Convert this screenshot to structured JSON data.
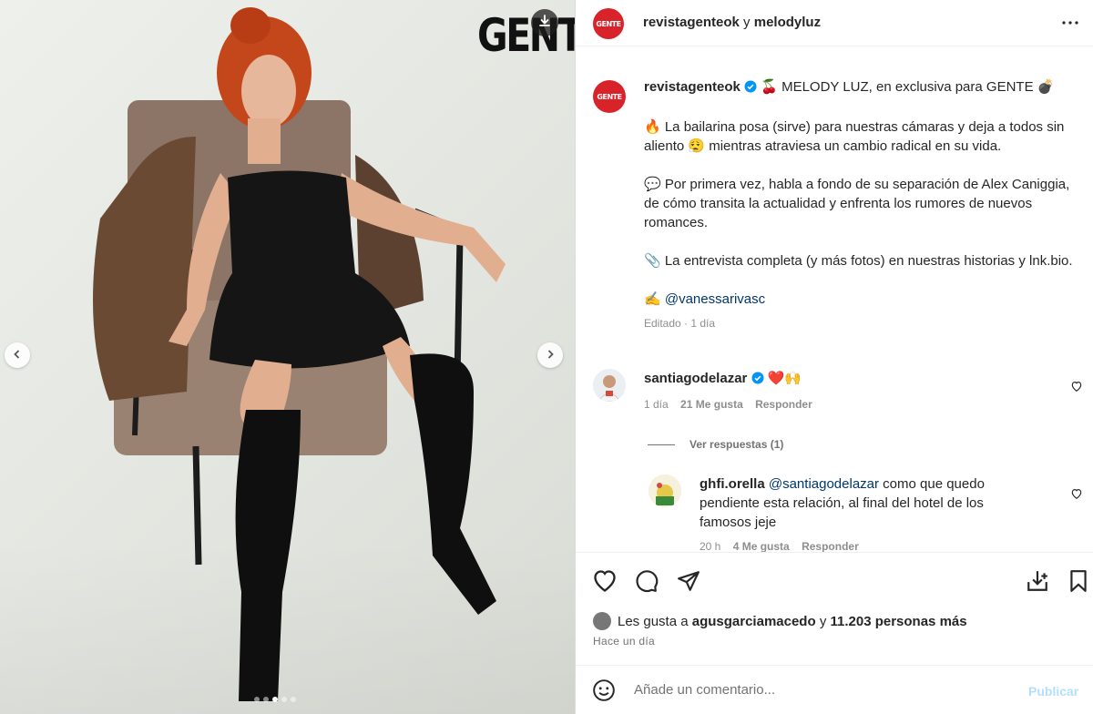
{
  "photo": {
    "brand_logo": "GENTE",
    "carousel_dots": 5,
    "active_dot": 3
  },
  "header": {
    "author": "revistagenteok",
    "connector": " y ",
    "collaborator": "melodyluz",
    "avatar_text": "GENTE"
  },
  "caption": {
    "username": "revistagenteok",
    "lines": [
      "🍒 MELODY LUZ, en exclusiva para GENTE 💣",
      "🔥 La bailarina posa (sirve) para nuestras cámaras y deja a todos sin aliento 😮‍💨 mientras atraviesa un cambio radical en su vida.",
      "💬 Por primera vez, habla a fondo de su separación de Alex Caniggia, de cómo transita la actualidad y enfrenta los rumores de nuevos romances.",
      "📎 La entrevista completa (y más fotos) en nuestras historias y lnk.bio."
    ],
    "credit_emoji": "✍️",
    "credit_mention": "@vanessarivasc",
    "meta": "Editado · 1 día"
  },
  "comments": [
    {
      "username": "santiagodelazar",
      "text": "❤️🙌",
      "time": "1 día",
      "likes": "21 Me gusta",
      "reply": "Responder"
    },
    {
      "username": "ghfi.orella",
      "mention": "@santiagodelazar",
      "text": " como que quedo pendiente esta relación, al final del hotel de los famosos jeje",
      "time": "20 h",
      "likes": "4 Me gusta",
      "reply": "Responder"
    }
  ],
  "view_replies": "Ver respuestas (1)",
  "likes": {
    "prefix": "Les gusta a ",
    "user": "agusgarciamacedo",
    "middle": " y ",
    "count": "11.203 personas más"
  },
  "ago": "Hace un día",
  "add_comment": {
    "placeholder": "Añade un comentario...",
    "post_label": "Publicar"
  },
  "icons": [
    "download-icon",
    "chevron-left-icon",
    "chevron-right-icon",
    "more-icon",
    "verified-icon",
    "heart-icon",
    "comment-icon",
    "share-icon",
    "save-to-collection-icon",
    "bookmark-icon",
    "emoji-icon"
  ],
  "colors": {
    "gente_red": "#d8232a",
    "verified_blue": "#0095f6",
    "post_disabled": "#b2dffc",
    "mention": "#00376b"
  }
}
